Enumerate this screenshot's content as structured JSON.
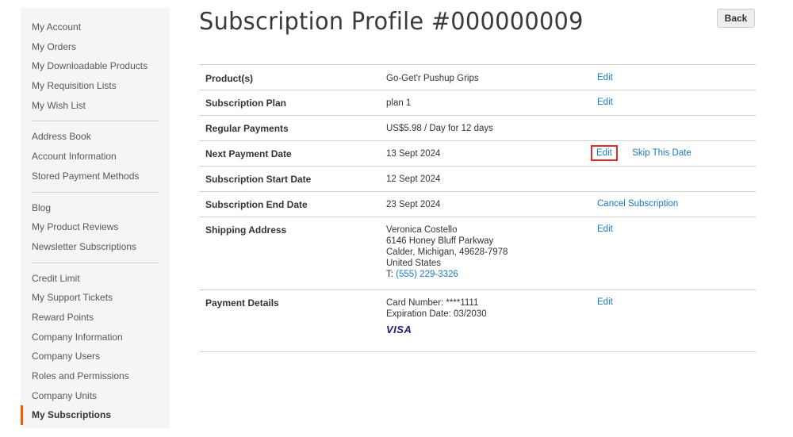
{
  "sidebar": {
    "groups": [
      [
        "My Account",
        "My Orders",
        "My Downloadable Products",
        "My Requisition Lists",
        "My Wish List"
      ],
      [
        "Address Book",
        "Account Information",
        "Stored Payment Methods"
      ],
      [
        "Blog",
        "My Product Reviews",
        "Newsletter Subscriptions"
      ],
      [
        "Credit Limit",
        "My Support Tickets",
        "Reward Points",
        "Company Information",
        "Company Users",
        "Roles and Permissions",
        "Company Units",
        "My Subscriptions"
      ]
    ],
    "active": "My Subscriptions",
    "accent_color": "#ff5501"
  },
  "header": {
    "title": "Subscription Profile #000000009",
    "back_label": "Back"
  },
  "details": {
    "product": {
      "label": "Product(s)",
      "value": "Go-Get'r Pushup Grips",
      "action": "Edit"
    },
    "plan": {
      "label": "Subscription Plan",
      "value": "plan 1",
      "action": "Edit"
    },
    "regular": {
      "label": "Regular Payments",
      "value": "US$5.98 / Day for 12 days"
    },
    "next": {
      "label": "Next Payment Date",
      "value": "13 Sept 2024",
      "action": "Edit",
      "action2": "Skip This Date"
    },
    "start": {
      "label": "Subscription Start Date",
      "value": "12 Sept 2024"
    },
    "end": {
      "label": "Subscription End Date",
      "value": "23 Sept 2024",
      "action": "Cancel Subscription"
    },
    "shipping": {
      "label": "Shipping Address",
      "name": "Veronica Costello",
      "street": "6146 Honey Bluff Parkway",
      "city": "Calder, Michigan, 49628-7978",
      "country": "United States",
      "phone_prefix": "T: ",
      "phone": "(555) 229-3326",
      "action": "Edit"
    },
    "payment": {
      "label": "Payment Details",
      "card": "Card Number: ****1111",
      "expiry": "Expiration Date: 03/2030",
      "brand": "VISA",
      "action": "Edit"
    }
  },
  "colors": {
    "link": "#1979c3",
    "highlight": "#e02b27"
  }
}
